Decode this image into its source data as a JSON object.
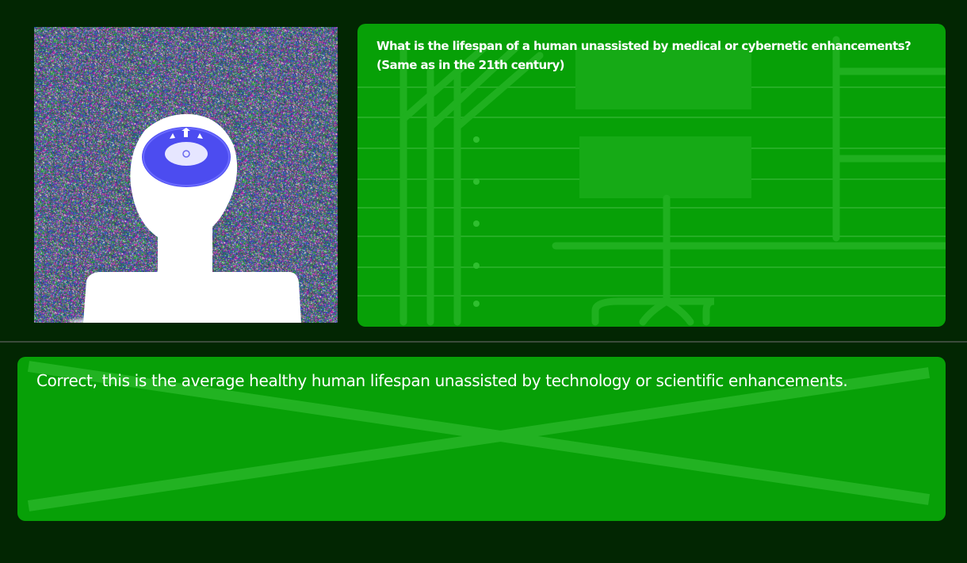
{
  "question": {
    "line1": "What is the lifespan of a human unassisted by medical or cybernetic enhancements?",
    "line2": "(Same as in the 21th century)"
  },
  "response": {
    "text": "Correct, this is the average healthy human lifespan unassisted by technology or scientific enhancements."
  },
  "colors": {
    "background": "#022602",
    "panel": "#07a007",
    "panel_deco": "#2dbd2d",
    "text": "#ffffff",
    "figure": "#ffffff",
    "eye_outer": "#4c4cf0",
    "eye_inner": "#e6e6ff"
  },
  "icons": {
    "portrait": "humanoid-silhouette-with-eye",
    "eye": "eye-icon"
  }
}
